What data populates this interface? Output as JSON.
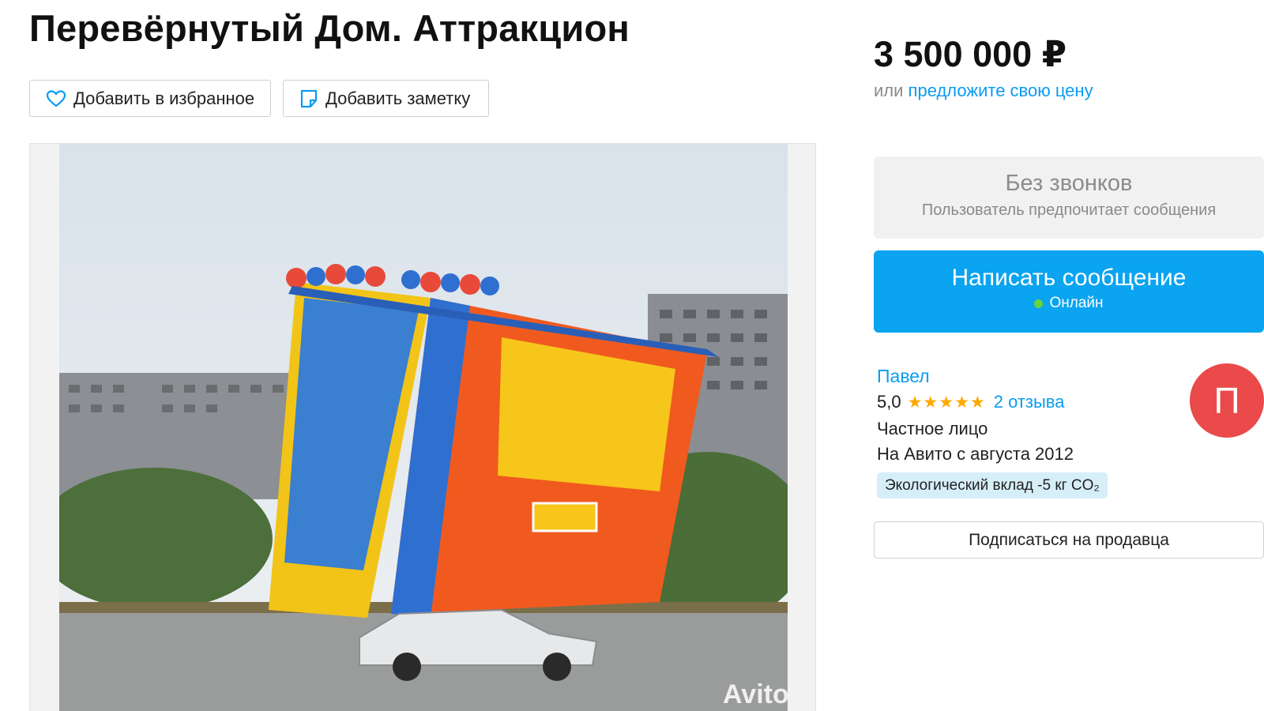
{
  "listing": {
    "title": "Перевёрнутый Дом. Аттракцион",
    "favorite_label": "Добавить в избранное",
    "note_label": "Добавить заметку",
    "watermark": "Avito"
  },
  "price": {
    "amount": "3 500 000 ₽",
    "prefix": "или",
    "offer_link": "предложите свою цену"
  },
  "contact": {
    "no_calls_title": "Без звонков",
    "no_calls_subtitle": "Пользователь предпочитает сообщения",
    "message_button": "Написать сообщение",
    "online_status": "Онлайн"
  },
  "seller": {
    "name": "Павел",
    "rating": "5,0",
    "stars": "★★★★★",
    "reviews": "2 отзыва",
    "type": "Частное лицо",
    "since": "На Авито с августа 2012",
    "eco": "Экологический вклад -5 кг CO₂",
    "avatar_letter": "П",
    "subscribe_label": "Подписаться на продавца"
  },
  "colors": {
    "accent": "#0aa4f0",
    "link": "#0a9cf0",
    "avatar": "#ea4a4a",
    "online": "#6ad33a",
    "stars": "#ffa800"
  }
}
